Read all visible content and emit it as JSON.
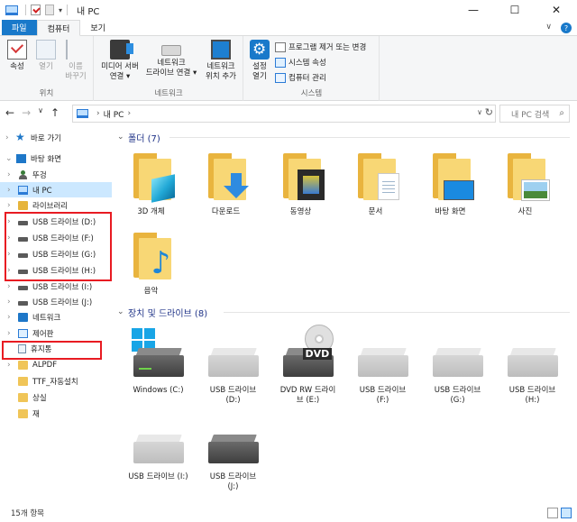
{
  "titlebar": {
    "title": "내 PC",
    "qat_dropdown": "▾",
    "minimize": "—",
    "maximize": "☐",
    "close": "✕"
  },
  "ribbon_tabs": {
    "file": "파일",
    "computer": "컴퓨터",
    "view": "보기",
    "collapse": "∨",
    "help": "?"
  },
  "ribbon": {
    "location": {
      "label": "위치",
      "properties": "속성",
      "open": "열기",
      "rename": "이름\n바꾸기"
    },
    "network": {
      "label": "네트워크",
      "media_server": "미디어 서버\n연결 ▾",
      "map_drive": "네트워크\n드라이브 연결 ▾",
      "add_location": "네트워크\n위치 추가"
    },
    "system": {
      "label": "시스템",
      "settings": "설정\n열기",
      "uninstall": "프로그램 제거 또는 변경",
      "system_props": "시스템 속성",
      "manage": "컴퓨터 관리"
    }
  },
  "address": {
    "back": "←",
    "forward": "→",
    "recent": "∨",
    "up": "↑",
    "crumb_pc": "내 PC",
    "chevron": "›",
    "dropdown": "∨",
    "refresh": "↻",
    "search_placeholder": "내 PC 검색",
    "search_icon": "search-icon"
  },
  "nav": {
    "items": [
      {
        "label": "바로 가기",
        "icon": "star-icon",
        "expander": "›"
      },
      {
        "label": "바탕 화면",
        "icon": "desktop-icon",
        "expander": "⌄"
      },
      {
        "label": "뚜겅",
        "icon": "user-icon",
        "expander": "›"
      },
      {
        "label": "내 PC",
        "icon": "pc-icon",
        "expander": "›"
      },
      {
        "label": "라이브러리",
        "icon": "library-icon",
        "expander": "›"
      },
      {
        "label": "USB 드라이브 (D:)",
        "icon": "usb-drive-icon",
        "expander": "›"
      },
      {
        "label": "USB 드라이브 (F:)",
        "icon": "usb-drive-icon",
        "expander": "›"
      },
      {
        "label": "USB 드라이브 (G:)",
        "icon": "usb-drive-icon",
        "expander": "›"
      },
      {
        "label": "USB 드라이브 (H:)",
        "icon": "usb-drive-icon",
        "expander": "›"
      },
      {
        "label": "USB 드라이브 (I:)",
        "icon": "usb-drive-icon",
        "expander": "›"
      },
      {
        "label": "USB 드라이브 (J:)",
        "icon": "usb-drive-icon",
        "expander": "›"
      },
      {
        "label": "네트워크",
        "icon": "network-icon",
        "expander": "›"
      },
      {
        "label": "제어판",
        "icon": "control-panel-icon",
        "expander": "›"
      },
      {
        "label": "휴지통",
        "icon": "recycle-bin-icon",
        "expander": ""
      },
      {
        "label": "ALPDF",
        "icon": "folder-icon",
        "expander": "›"
      },
      {
        "label": "TTF_자동설치",
        "icon": "folder-icon",
        "expander": ""
      },
      {
        "label": "상실",
        "icon": "folder-icon",
        "expander": ""
      },
      {
        "label": "재",
        "icon": "folder-icon",
        "expander": ""
      }
    ]
  },
  "content": {
    "folders_header": "폴더 (7)",
    "devices_header": "장치 및 드라이브 (8)",
    "caret": "⌄",
    "folders": [
      {
        "label": "3D 개체",
        "overlay": "cube-icon"
      },
      {
        "label": "다운로드",
        "overlay": "download-arrow-icon"
      },
      {
        "label": "동영상",
        "overlay": "film-icon"
      },
      {
        "label": "문서",
        "overlay": "document-icon"
      },
      {
        "label": "바탕 화면",
        "overlay": "monitor-icon"
      },
      {
        "label": "사진",
        "overlay": "photo-icon"
      },
      {
        "label": "음악",
        "overlay": "music-note-icon"
      }
    ],
    "drives": [
      {
        "label": "Windows (C:)",
        "type": "windows-drive-icon"
      },
      {
        "label": "USB 드라이브\n(D:)",
        "type": "usb-drive-icon"
      },
      {
        "label": "DVD RW 드라이\n브 (E:)",
        "type": "dvd-drive-icon",
        "dvd_text": "DVD"
      },
      {
        "label": "USB 드라이브\n(F:)",
        "type": "usb-drive-icon"
      },
      {
        "label": "USB 드라이브\n(G:)",
        "type": "usb-drive-icon"
      },
      {
        "label": "USB 드라이브\n(H:)",
        "type": "usb-drive-icon"
      },
      {
        "label": "USB 드라이브 (I:)",
        "type": "usb-drive-icon"
      },
      {
        "label": "USB 드라이브\n(J:)",
        "type": "usb-drive-icon"
      }
    ]
  },
  "status": {
    "count": "15개 항목"
  },
  "colors": {
    "accent": "#1979ca",
    "selection": "#cce8ff",
    "highlight_box": "#e81b22",
    "section_header": "#1e3287"
  }
}
